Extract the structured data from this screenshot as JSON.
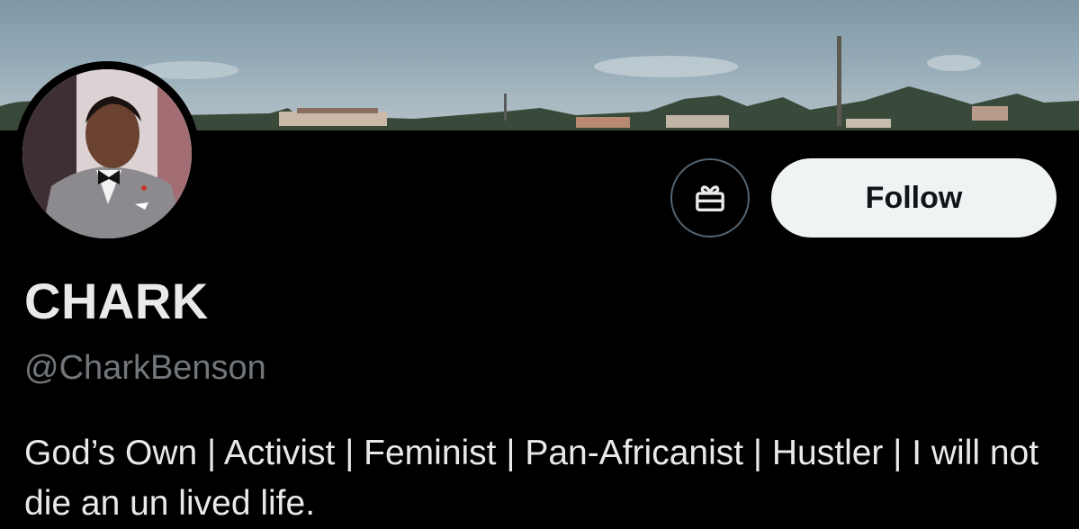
{
  "profile": {
    "display_name": "CHARK",
    "handle": "@CharkBenson",
    "bio": "God’s Own | Activist | Feminist | Pan-Africanist | Hustler | I will not die an un lived life."
  },
  "actions": {
    "follow_label": "Follow",
    "gift_icon": "gift-icon"
  },
  "colors": {
    "background": "#000000",
    "follow_bg": "#eff3f4",
    "handle_gray": "#71767b"
  }
}
